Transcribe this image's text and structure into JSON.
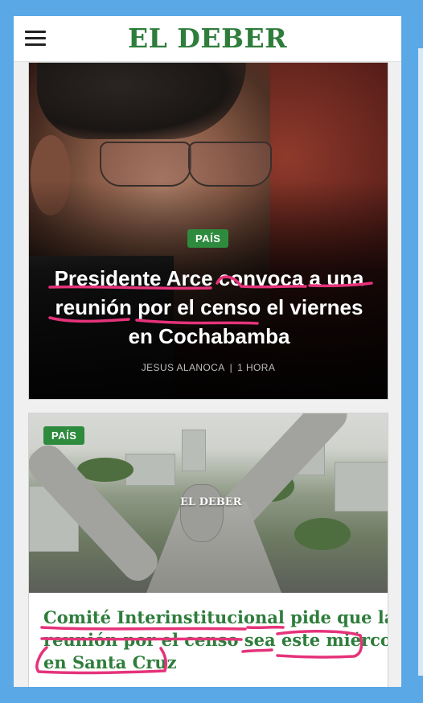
{
  "header": {
    "brand": "EL DEBER",
    "menu_icon": "hamburger-menu-icon"
  },
  "articles": [
    {
      "category": "PAÍS",
      "headline_lines": [
        "Presidente Arce convoca a una",
        "reunión por el censo el viernes",
        "en Cochabamba"
      ],
      "author": "JESUS ALANOCA",
      "separator": "|",
      "time": "1 HORA"
    },
    {
      "category": "PAÍS",
      "image_watermark": "EL DEBER",
      "headline_lines": [
        "Comité Interinstitucional pide que la",
        "reunión por el censo sea este miércoles",
        "en Santa Cruz"
      ]
    }
  ],
  "colors": {
    "brand_green": "#2e7d3b",
    "badge_green": "#2e8b3e",
    "annotation_pink": "#e5337a",
    "frame_blue": "#5aa9e6"
  }
}
